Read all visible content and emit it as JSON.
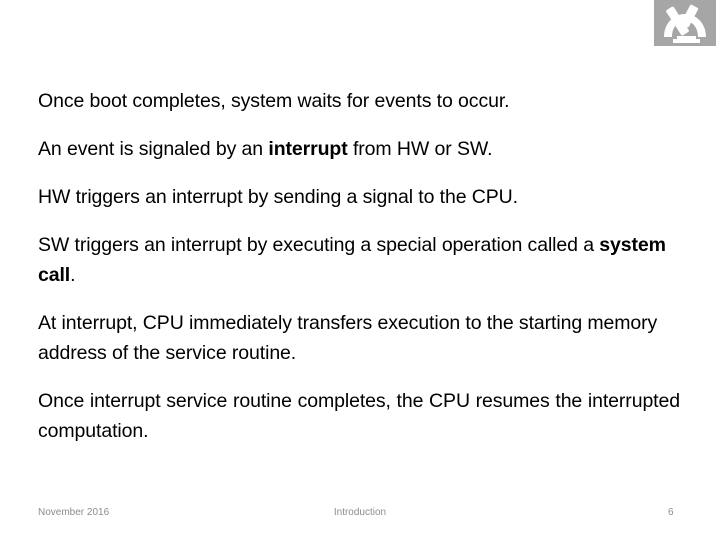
{
  "slide": {
    "background_color": "#ffffff",
    "text_color": "#000000",
    "logo": {
      "icon": "microscope-icon",
      "box_color": "#a6a6a6",
      "glyph_color": "#ffffff"
    },
    "body": [
      {
        "id": "p1",
        "align": "left",
        "runs": [
          {
            "text": "Once boot completes, system waits for events to occur.",
            "bold": false
          }
        ]
      },
      {
        "id": "p2",
        "align": "left",
        "runs": [
          {
            "text": "An event is signaled by an ",
            "bold": false
          },
          {
            "text": "interrupt",
            "bold": true
          },
          {
            "text": " from HW or SW.",
            "bold": false
          }
        ]
      },
      {
        "id": "p3",
        "align": "left",
        "runs": [
          {
            "text": "HW triggers an interrupt by sending a signal to the CPU.",
            "bold": false
          }
        ]
      },
      {
        "id": "p4",
        "align": "left",
        "runs": [
          {
            "text": "SW triggers an interrupt by executing a special operation called a ",
            "bold": false
          },
          {
            "text": "system call",
            "bold": true
          },
          {
            "text": ".",
            "bold": false
          }
        ]
      },
      {
        "id": "p5",
        "align": "left",
        "runs": [
          {
            "text": "At interrupt, CPU immediately transfers execution to the starting memory address of the service routine.",
            "bold": false
          }
        ]
      },
      {
        "id": "p6",
        "align": "justify",
        "runs": [
          {
            "text": "Once interrupt service routine completes, the CPU resumes the interrupted computation.",
            "bold": false
          }
        ]
      }
    ],
    "footer": {
      "date": "November 2016",
      "title": "Introduction",
      "page_number": "6",
      "color": "#8c8c8c"
    }
  }
}
